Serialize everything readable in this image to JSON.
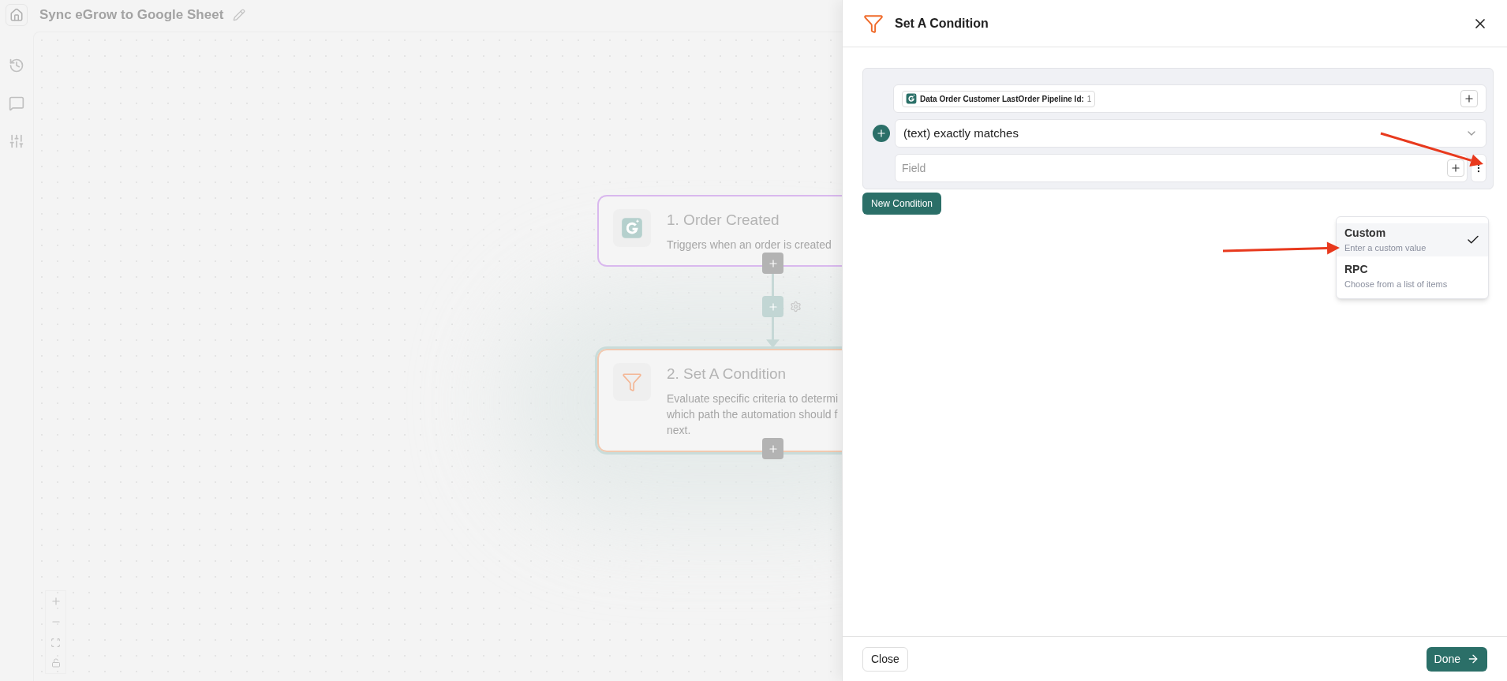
{
  "canvas": {
    "title": "Sync eGrow to Google Sheet",
    "nodes": [
      {
        "kind": "trigger",
        "title": "1. Order Created",
        "description_lines": [
          "Triggers when an order is created"
        ]
      },
      {
        "kind": "filter",
        "title": "2. Set A Condition",
        "description_lines": [
          "Evaluate specific criteria to determi",
          "which path the automation should f",
          "next."
        ]
      }
    ]
  },
  "panel": {
    "title": "Set A Condition",
    "condition": {
      "token": {
        "label": "Data Order Customer LastOrder Pipeline Id:",
        "value": "1"
      },
      "operator": "(text) exactly matches",
      "value_placeholder": "Field"
    },
    "new_condition": "New Condition",
    "menu": [
      {
        "label": "Custom",
        "hint": "Enter a custom value",
        "selected": true
      },
      {
        "label": "RPC",
        "hint": "Choose from a list of items",
        "selected": false
      }
    ],
    "close": "Close",
    "done": "Done"
  }
}
